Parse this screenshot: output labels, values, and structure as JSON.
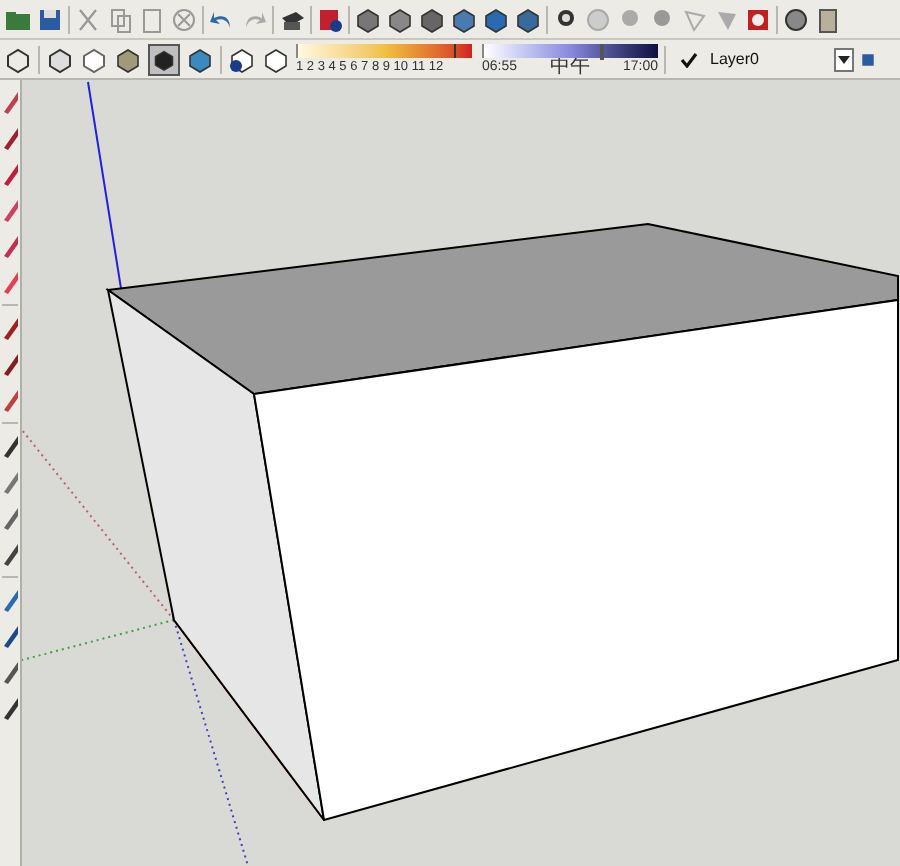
{
  "shadow_settings": {
    "months": "1 2 3 4 5 6 7 8 9 10 11 12",
    "month_slider": {
      "level": 0.9
    },
    "time_start": "06:55",
    "time_middle": "中午",
    "time_end": "17:00",
    "time_slider": {
      "level": 0.67
    }
  },
  "layer": {
    "name": "Layer0",
    "current": true
  }
}
